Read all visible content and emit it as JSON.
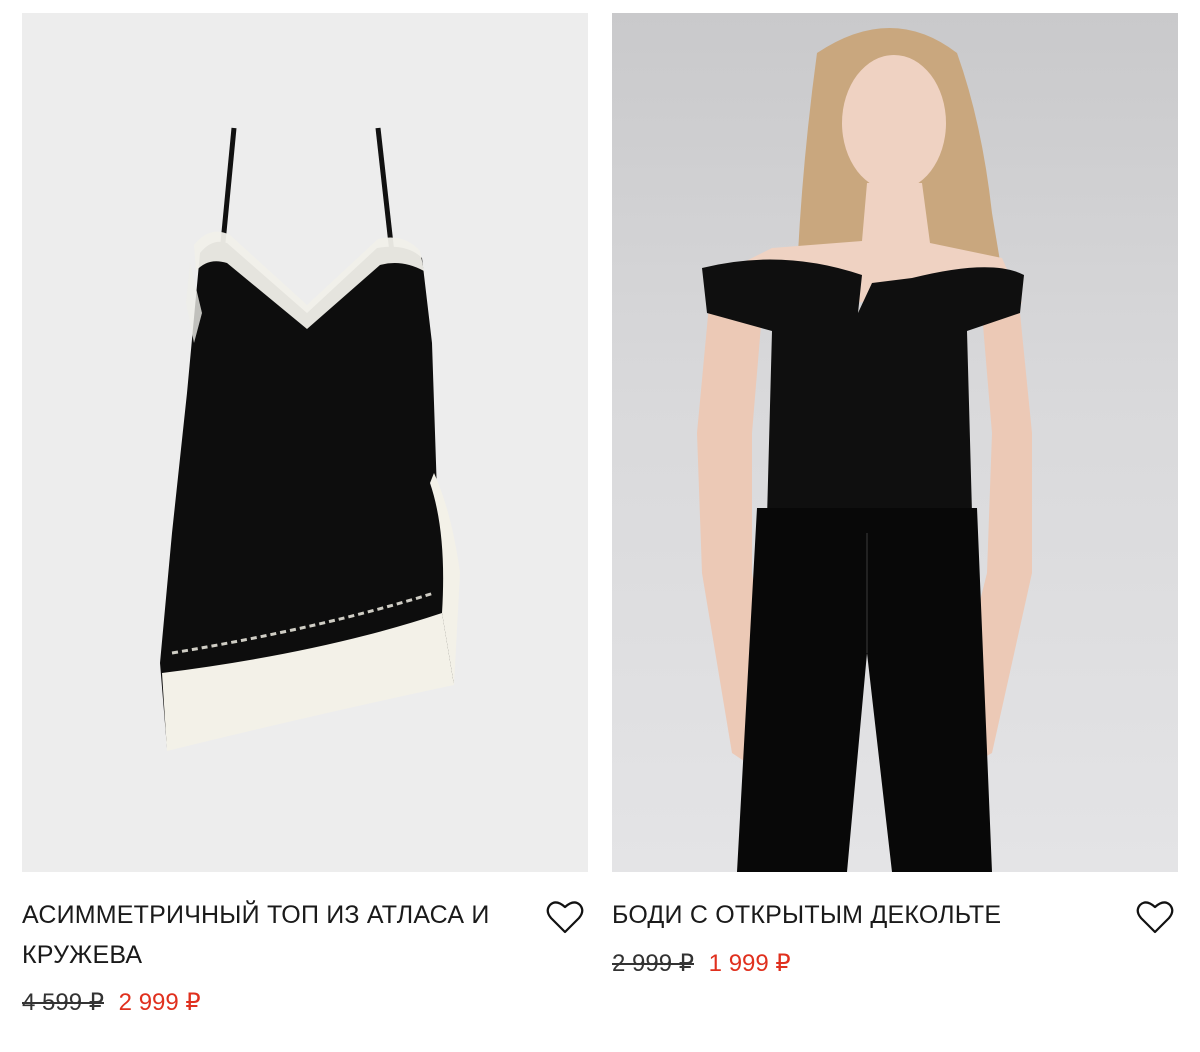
{
  "products": [
    {
      "title": "АСИММЕТРИЧНЫЙ ТОП ИЗ АТЛАСА И КРУЖЕВА",
      "old_price": "4 599 ₽",
      "new_price": "2 999 ₽",
      "image": "black-satin-lace-slip-top"
    },
    {
      "title": "БОДИ С ОТКРЫТЫМ ДЕКОЛЬТЕ",
      "old_price": "2 999 ₽",
      "new_price": "1 999 ₽",
      "image": "model-black-off-shoulder-bodysuit"
    }
  ],
  "colors": {
    "sale": "#e0301e",
    "text": "#1a1a1a",
    "left_background": "#ededed"
  },
  "icons": [
    "heart-icon"
  ]
}
